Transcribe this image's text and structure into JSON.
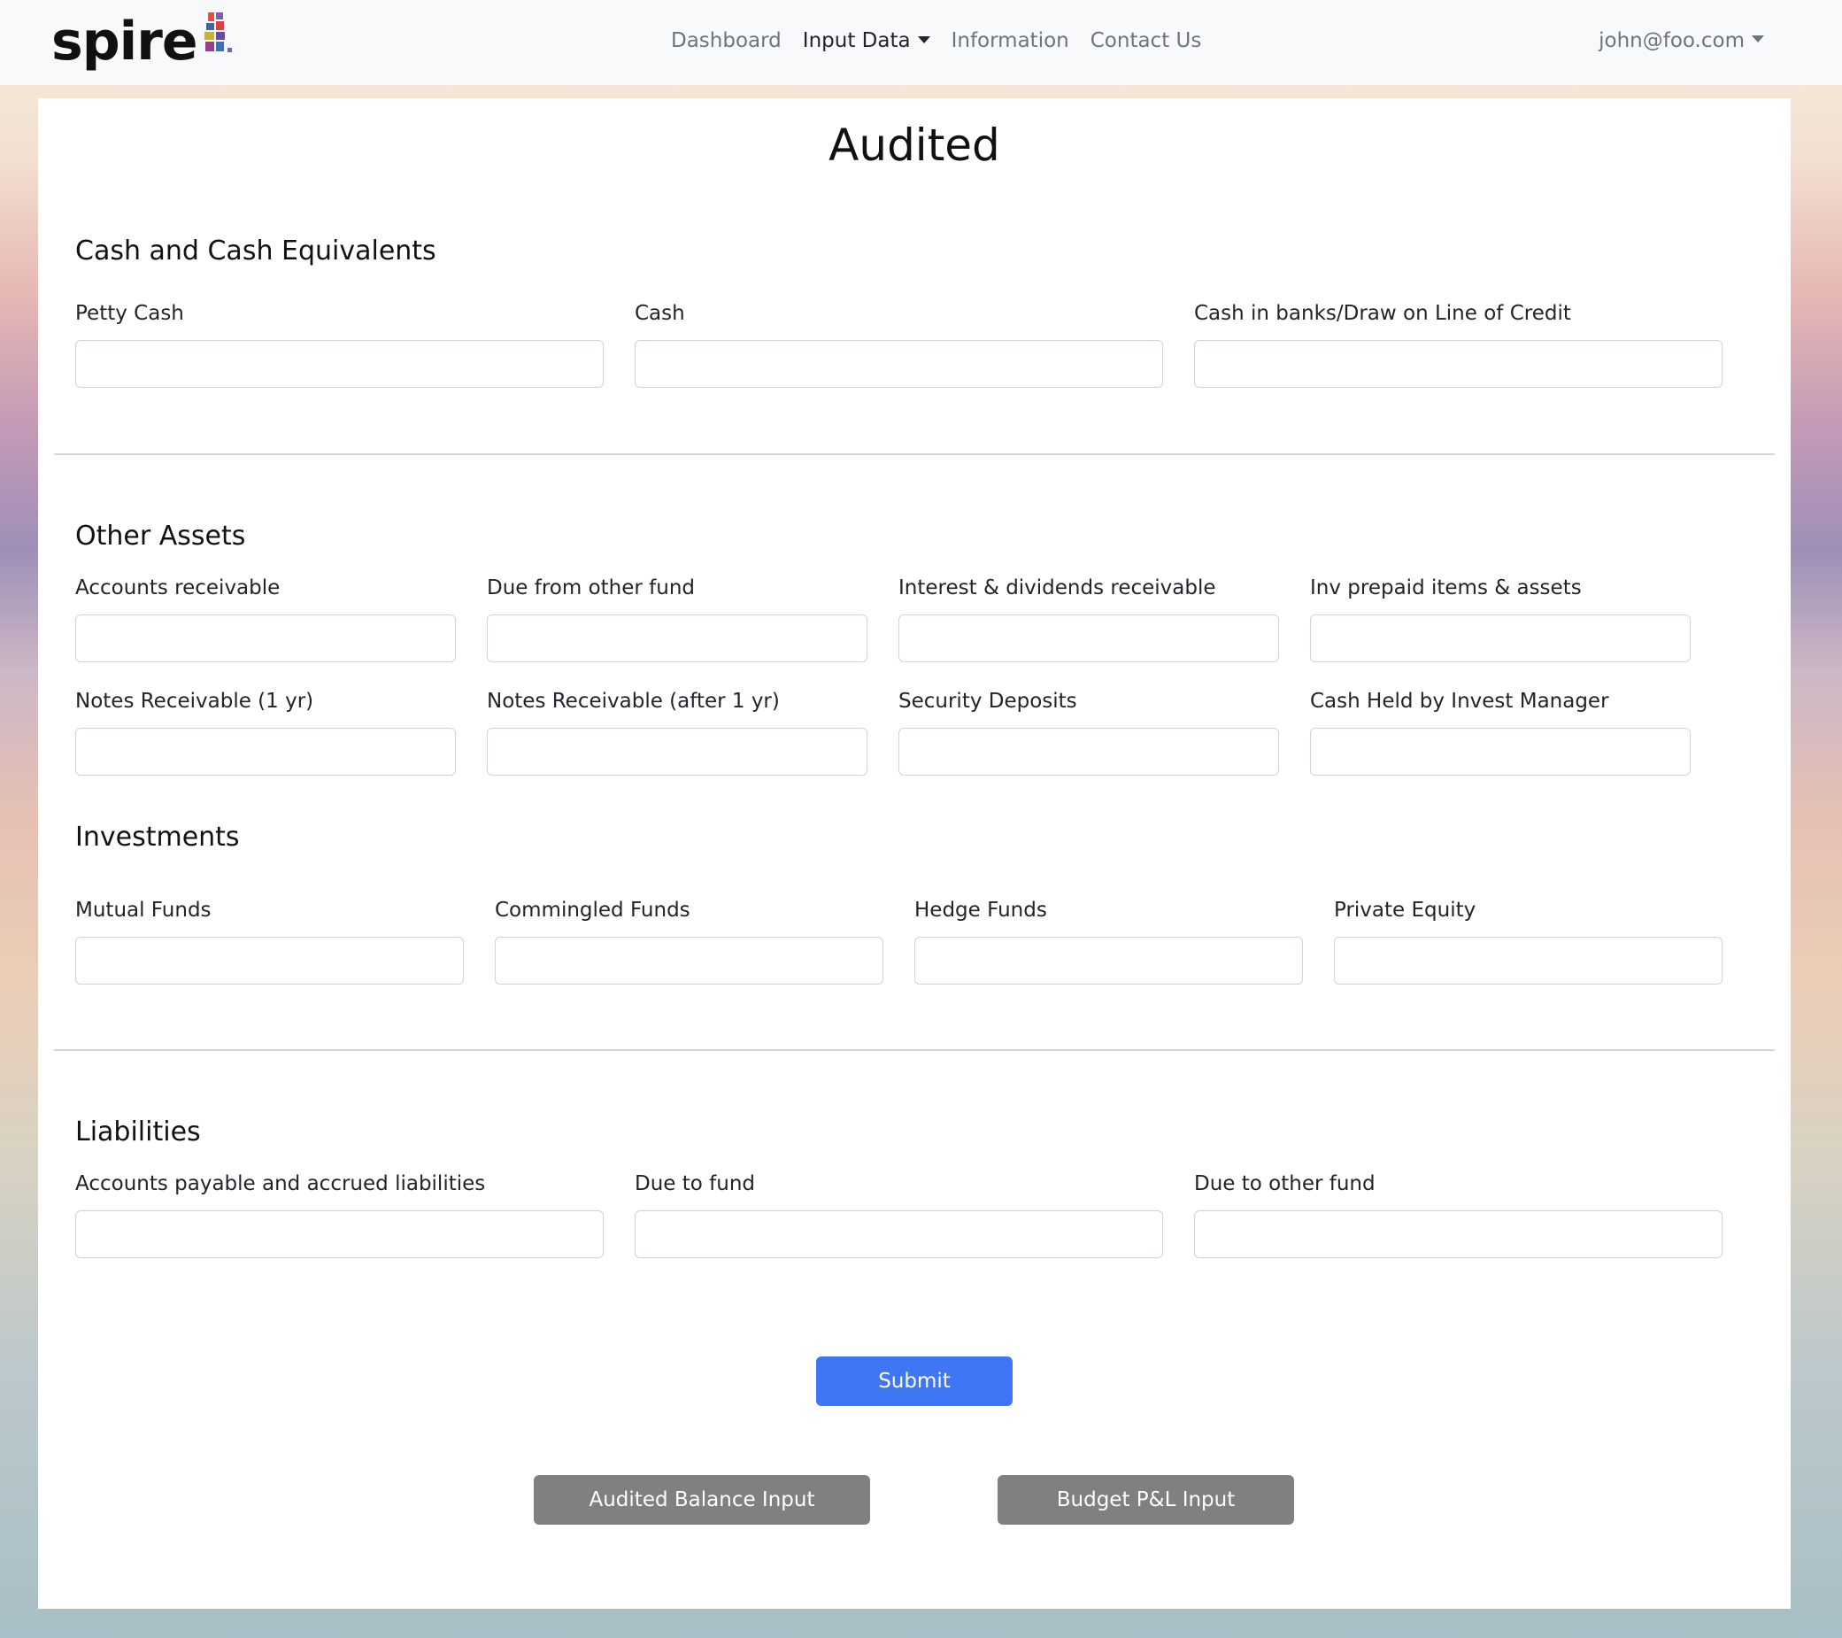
{
  "brand": {
    "name": "spire"
  },
  "nav": {
    "links": [
      {
        "label": "Dashboard"
      },
      {
        "label": "Input Data"
      },
      {
        "label": "Information"
      },
      {
        "label": "Contact Us"
      }
    ],
    "user": "john@foo.com"
  },
  "page": {
    "title": "Audited"
  },
  "sections": {
    "cash": {
      "title": "Cash and Cash Equivalents",
      "fields": [
        {
          "label": "Petty Cash",
          "value": ""
        },
        {
          "label": "Cash",
          "value": ""
        },
        {
          "label": "Cash in banks/Draw on Line of Credit",
          "value": ""
        }
      ]
    },
    "other_assets": {
      "title": "Other Assets",
      "fields": [
        {
          "label": "Accounts receivable",
          "value": ""
        },
        {
          "label": "Due from other fund",
          "value": ""
        },
        {
          "label": "Interest & dividends receivable",
          "value": ""
        },
        {
          "label": "Inv prepaid items & assets",
          "value": ""
        },
        {
          "label": "Notes Receivable (1 yr)",
          "value": ""
        },
        {
          "label": "Notes Receivable (after 1 yr)",
          "value": ""
        },
        {
          "label": "Security Deposits",
          "value": ""
        },
        {
          "label": "Cash Held by Invest Manager",
          "value": ""
        }
      ]
    },
    "investments": {
      "title": "Investments",
      "fields": [
        {
          "label": "Mutual Funds",
          "value": ""
        },
        {
          "label": "Commingled Funds",
          "value": ""
        },
        {
          "label": "Hedge Funds",
          "value": ""
        },
        {
          "label": "Private Equity",
          "value": ""
        }
      ]
    },
    "liabilities": {
      "title": "Liabilities",
      "fields": [
        {
          "label": "Accounts payable and accrued liabilities",
          "value": ""
        },
        {
          "label": "Due to fund",
          "value": ""
        },
        {
          "label": "Due to other fund",
          "value": ""
        }
      ]
    }
  },
  "actions": {
    "submit": "Submit",
    "audited_balance": "Audited Balance Input",
    "budget_pl": "Budget P&L Input"
  },
  "colors": {
    "primary": "#3f76f3",
    "secondary": "#808080",
    "navbar": "#f8f9fa"
  }
}
